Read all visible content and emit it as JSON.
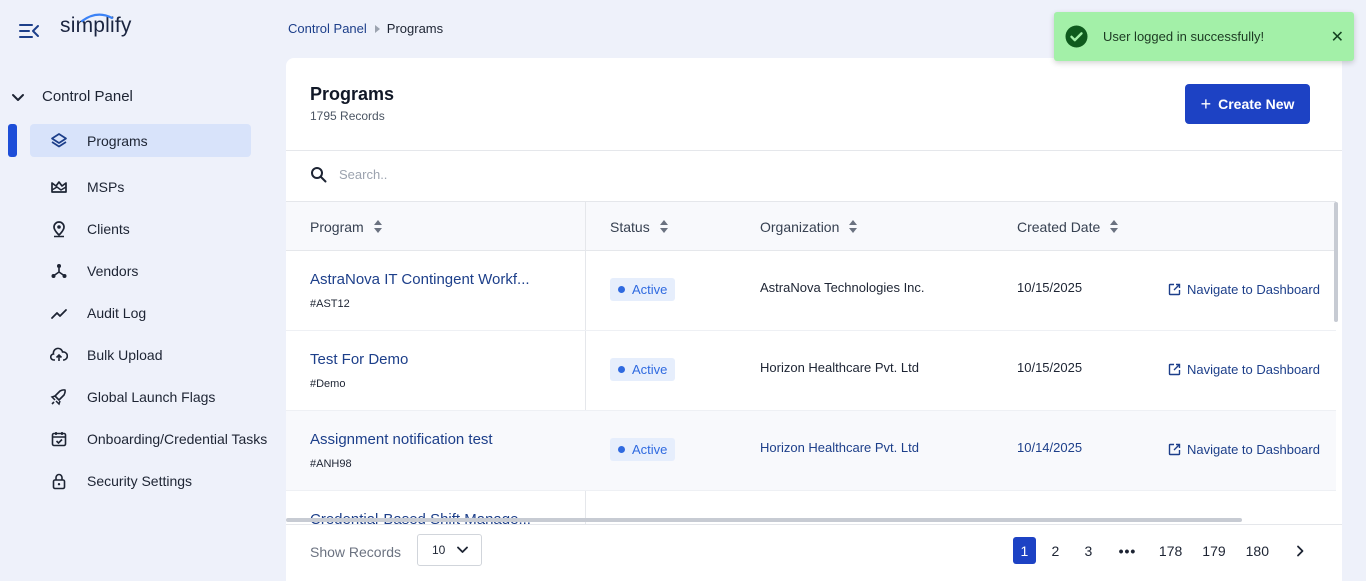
{
  "app": {
    "logo_text": "simplify"
  },
  "sidebar": {
    "section_label": "Control Panel",
    "items": [
      {
        "label": "Programs",
        "icon": "layers-icon"
      },
      {
        "label": "MSPs",
        "icon": "image-icon"
      },
      {
        "label": "Clients",
        "icon": "map-pin-icon"
      },
      {
        "label": "Vendors",
        "icon": "network-icon"
      },
      {
        "label": "Audit Log",
        "icon": "trend-line-icon"
      },
      {
        "label": "Bulk Upload",
        "icon": "cloud-upload-icon"
      },
      {
        "label": "Global Launch Flags",
        "icon": "rocket-icon"
      },
      {
        "label": "Onboarding/Credential Tasks",
        "icon": "calendar-check-icon"
      },
      {
        "label": "Security Settings",
        "icon": "lock-icon"
      }
    ]
  },
  "breadcrumb": {
    "parent": "Control Panel",
    "current": "Programs"
  },
  "page": {
    "title": "Programs",
    "record_count": "1795 Records",
    "create_label": "Create New",
    "search_placeholder": "Search.."
  },
  "table": {
    "columns": [
      "Program",
      "Status",
      "Organization",
      "Created Date"
    ],
    "rows": [
      {
        "program": "AstraNova IT Contingent Workf...",
        "code": "#AST12",
        "status": "Active",
        "organization": "AstraNova Technologies Inc.",
        "created": "10/15/2025",
        "action": "Navigate to Dashboard"
      },
      {
        "program": "Test For Demo",
        "code": "#Demo",
        "status": "Active",
        "organization": "Horizon Healthcare Pvt. Ltd",
        "created": "10/15/2025",
        "action": "Navigate to Dashboard"
      },
      {
        "program": "Assignment notification test",
        "code": "#ANH98",
        "status": "Active",
        "organization": "Horizon Healthcare Pvt. Ltd",
        "created": "10/14/2025",
        "action": "Navigate to Dashboard"
      },
      {
        "program": "Credential-Based Shift Manage..."
      }
    ]
  },
  "footer": {
    "show_records_label": "Show Records",
    "page_size": "10",
    "pages": [
      "1",
      "2",
      "3",
      "•••",
      "178",
      "179",
      "180"
    ],
    "current_page": "1"
  },
  "toast": {
    "message": "User logged in successfully!",
    "close": "✕"
  },
  "colors": {
    "accent": "#1d42c4",
    "link": "#1d3f8a",
    "toast_bg": "#a3f0a8",
    "active_nav_bg": "#d8e3fa"
  }
}
